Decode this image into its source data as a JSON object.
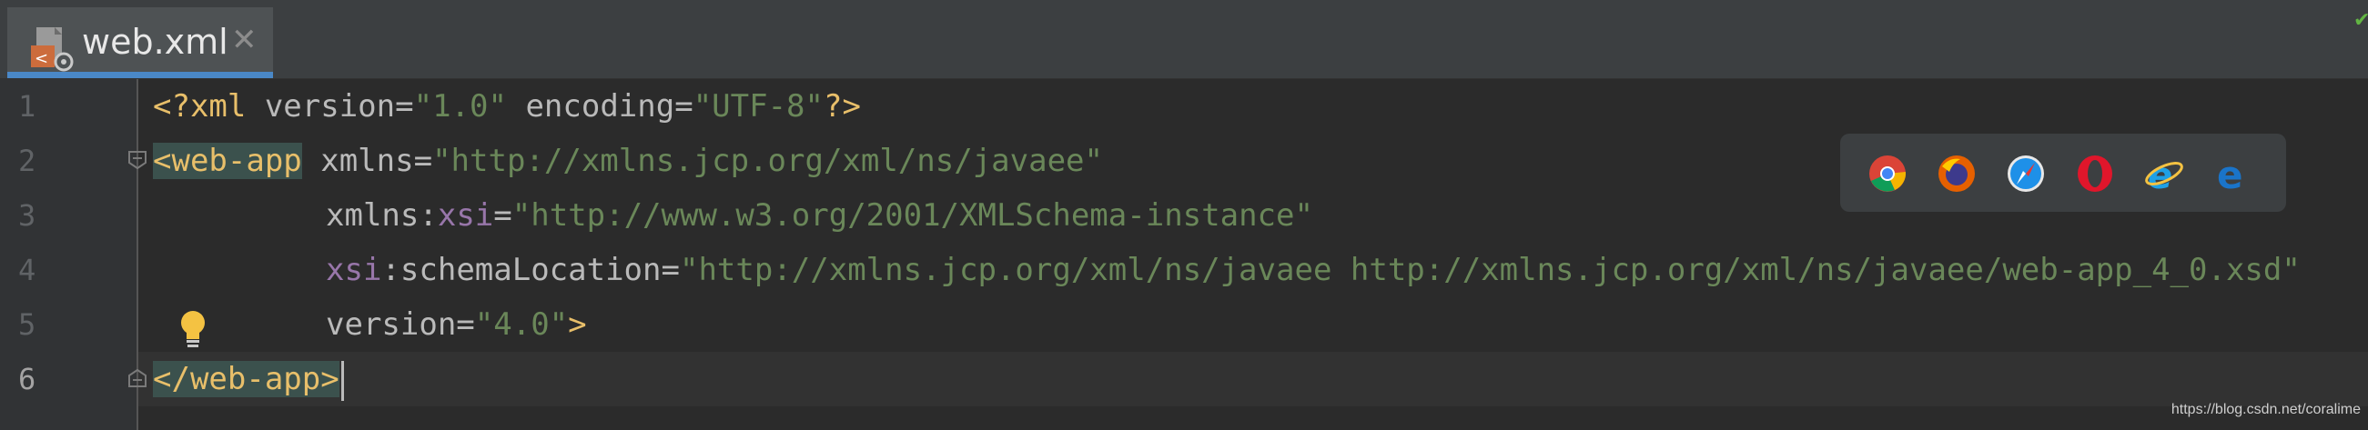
{
  "tab": {
    "label": "web.xml",
    "close": "✕"
  },
  "gutter": {
    "lines": [
      "1",
      "2",
      "3",
      "4",
      "5",
      "6"
    ]
  },
  "code": {
    "line1": {
      "open": "<?xml",
      "attr1": " version",
      "eq1": "=",
      "val1": "\"1.0\"",
      "attr2": " encoding",
      "eq2": "=",
      "val2": "\"UTF-8\"",
      "close": "?>"
    },
    "line2": {
      "tag": "<web-app",
      "attr": " xmlns",
      "eq": "=",
      "val": "\"http://xmlns.jcp.org/xml/ns/javaee\""
    },
    "line3": {
      "attr": "xmlns",
      "colon": ":",
      "ns": "xsi",
      "eq": "=",
      "val": "\"http://www.w3.org/2001/XMLSchema-instance\""
    },
    "line4": {
      "ns": "xsi",
      "colon": ":",
      "attr": "schemaLocation",
      "eq": "=",
      "val": "\"http://xmlns.jcp.org/xml/ns/javaee http://xmlns.jcp.org/xml/ns/javaee/web-app_4_0.xsd\""
    },
    "line5": {
      "attr": "version",
      "eq": "=",
      "val": "\"4.0\"",
      "close": ">"
    },
    "line6": {
      "tag": "</web-app>"
    }
  },
  "browsers": [
    "chrome-icon",
    "firefox-icon",
    "safari-icon",
    "opera-icon",
    "ie-icon",
    "edge-icon"
  ],
  "watermark": "https://blog.csdn.net/coralime",
  "colors": {
    "tag": "#e8bf6a",
    "value": "#6a8759",
    "namespace": "#9876aa",
    "attribute": "#bababa",
    "tab_underline": "#4a88c7"
  }
}
